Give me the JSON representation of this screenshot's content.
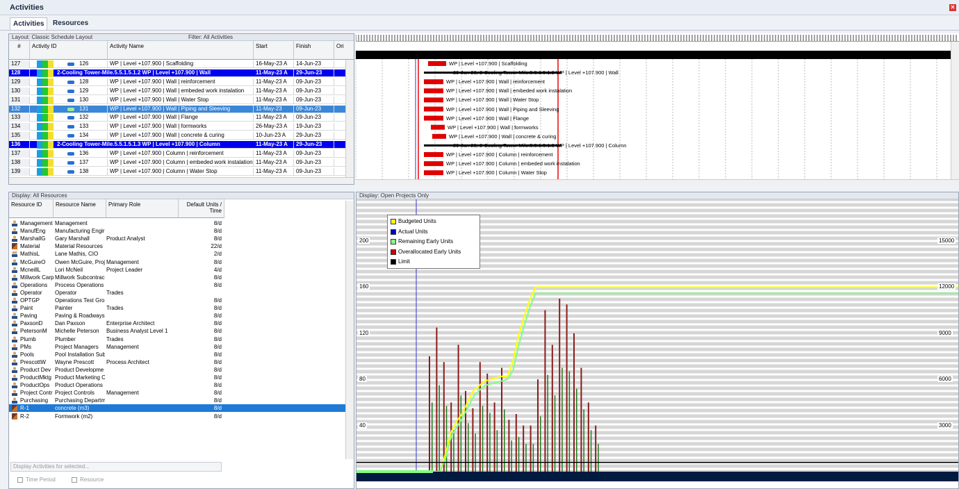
{
  "window": {
    "title": "Activities"
  },
  "tabs": [
    {
      "label": "Activities"
    },
    {
      "label": "Resources"
    }
  ],
  "activity_table": {
    "layout_label": "Layout: Classic Schedule Layout",
    "filter_label": "Filter: All Activities",
    "columns": {
      "num": "#",
      "id": "Activity ID",
      "name": "Activity Name",
      "start": "Start",
      "finish": "Finish",
      "orig": "Ori"
    },
    "rows": [
      {
        "num": "127",
        "id": "126",
        "name": "WP | Level +107.900 | Scaffolding",
        "start": "16-May-23 A",
        "finish": "14-Jun-23"
      },
      {
        "num": "128",
        "id": "2-Cooling Tower-Mile.5.5.1.5.1.2  WP | Level +107.900 | Wall",
        "name": "",
        "start": "11-May-23 A",
        "finish": "29-Jun-23"
      },
      {
        "num": "129",
        "id": "128",
        "name": "WP | Level +107.900 | Wall |  reinforcement",
        "start": "11-May-23 A",
        "finish": "09-Jun-23"
      },
      {
        "num": "130",
        "id": "129",
        "name": "WP | Level +107.900 | Wall | embeded work instalation",
        "start": "11-May-23 A",
        "finish": "09-Jun-23"
      },
      {
        "num": "131",
        "id": "130",
        "name": "WP | Level +107.900 | Wall | Water Stop",
        "start": "11-May-23 A",
        "finish": "09-Jun-23"
      },
      {
        "num": "132",
        "id": "131",
        "name": "WP | Level +107.900 | Wall | Piping and Sleeving",
        "start": "11-May-23",
        "finish": "09-Jun-23"
      },
      {
        "num": "133",
        "id": "132",
        "name": "WP | Level +107.900 | Wall | Flange",
        "start": "11-May-23 A",
        "finish": "09-Jun-23"
      },
      {
        "num": "134",
        "id": "133",
        "name": "WP | Level +107.900 | Wall |  formworks",
        "start": "26-May-23 A",
        "finish": "19-Jun-23"
      },
      {
        "num": "135",
        "id": "134",
        "name": "WP | Level +107.900 | Wall | concrete & curing",
        "start": "10-Jun-23 A",
        "finish": "29-Jun-23"
      },
      {
        "num": "136",
        "id": "2-Cooling Tower-Mile.5.5.1.5.1.3  WP | Level +107.900 | Column",
        "name": "",
        "start": "11-May-23 A",
        "finish": "29-Jun-23"
      },
      {
        "num": "137",
        "id": "136",
        "name": "WP | Level +107.900 | Column |  reinforcement",
        "start": "11-May-23 A",
        "finish": "09-Jun-23"
      },
      {
        "num": "138",
        "id": "137",
        "name": "WP | Level +107.900 | Column | embeded work instalation",
        "start": "11-May-23 A",
        "finish": "09-Jun-23"
      },
      {
        "num": "139",
        "id": "138",
        "name": "WP | Level +107.900 | Column | Water Stop",
        "start": "11-May-23 A",
        "finish": "09-Jun-23"
      }
    ]
  },
  "gantt_labels": [
    "WP | Level +107.900 | Scaffolding",
    "29-Jun-23, 2-Cooling Tower-Mile.5.5.1.5.1.2  WP | Level +107.900 | Wall",
    "WP | Level +107.900 | Wall |  reinforcement",
    "WP | Level +107.900 | Wall | embeded work instalation",
    "WP | Level +107.900 | Wall | Water Stop",
    "WP | Level +107.900 | Wall | Piping and Sleeving",
    "WP | Level +107.900 | Wall | Flange",
    "WP | Level +107.900 | Wall |  formworks",
    "WP | Level +107.900 | Wall | concrete & curing",
    "29-Jun-23, 2-Cooling Tower-Mile.5.5.1.5.1.3  WP | Level +107.900 | Column",
    "WP | Level +107.900 | Column |  reinforcement",
    "WP | Level +107.900 | Column | embeded work instalation",
    "WP | Level +107.900 | Column | Water Stop"
  ],
  "resource_table": {
    "display_label": "Display: All Resources",
    "columns": {
      "id": "Resource ID",
      "name": "Resource Name",
      "role": "Primary Role",
      "units": "Default Units / Time"
    },
    "rows": [
      {
        "icon": "person",
        "id": "Management",
        "name": "Management",
        "role": "",
        "units": "8/d"
      },
      {
        "icon": "person",
        "id": "ManufEng",
        "name": "Manufacturing Engir",
        "role": "",
        "units": "8/d"
      },
      {
        "icon": "person",
        "id": "MarshallG",
        "name": "Gary Marshall",
        "role": "Product Analyst",
        "units": "8/d"
      },
      {
        "icon": "mat",
        "id": "Material",
        "name": "Material Resources",
        "role": "",
        "units": "22/d"
      },
      {
        "icon": "group",
        "id": "MathisL",
        "name": "Lane Mathis, CIO",
        "role": "",
        "units": "2/d"
      },
      {
        "icon": "person",
        "id": "McGuireO",
        "name": "Owen McGuire, Proj",
        "role": "Management",
        "units": "8/d"
      },
      {
        "icon": "person",
        "id": "McneillL",
        "name": "Lori McNeil",
        "role": "Project Leader",
        "units": "4/d"
      },
      {
        "icon": "person",
        "id": "Millwork Carp",
        "name": "Millwork Subcontrac",
        "role": "",
        "units": "8/d"
      },
      {
        "icon": "person",
        "id": "Operations",
        "name": "Process Operations",
        "role": "",
        "units": "8/d"
      },
      {
        "icon": "person",
        "id": "Operator",
        "name": "Operator",
        "role": "Trades",
        "units": ""
      },
      {
        "icon": "person",
        "id": "OPTGP",
        "name": "Operations Test Gro",
        "role": "",
        "units": "8/d"
      },
      {
        "icon": "person",
        "id": "Paint",
        "name": "Painter",
        "role": "Trades",
        "units": "8/d"
      },
      {
        "icon": "person",
        "id": "Paving",
        "name": "Paving & Roadways",
        "role": "",
        "units": "8/d"
      },
      {
        "icon": "person",
        "id": "PaxsonD",
        "name": "Dan Paxson",
        "role": "Enterprise Architect",
        "units": "8/d"
      },
      {
        "icon": "person",
        "id": "PetersonM",
        "name": "Michelle Peterson",
        "role": "Business Analyst Level 1",
        "units": "8/d"
      },
      {
        "icon": "person",
        "id": "Plumb",
        "name": "Plumber",
        "role": "Trades",
        "units": "8/d"
      },
      {
        "icon": "person",
        "id": "PMs",
        "name": "Project Managers",
        "role": "Management",
        "units": "8/d"
      },
      {
        "icon": "person",
        "id": "Pools",
        "name": "Pool Installation Sub",
        "role": "",
        "units": "8/d"
      },
      {
        "icon": "person",
        "id": "PrescottW",
        "name": "Wayne Prescott",
        "role": "Process Architect",
        "units": "8/d"
      },
      {
        "icon": "person",
        "id": "Product Dev",
        "name": "Product Developme",
        "role": "",
        "units": "8/d"
      },
      {
        "icon": "person",
        "id": "ProductMktg",
        "name": "Product Marketing C",
        "role": "",
        "units": "8/d"
      },
      {
        "icon": "person",
        "id": "ProductOps",
        "name": "Product Operations",
        "role": "",
        "units": "8/d"
      },
      {
        "icon": "person",
        "id": "Project Contr",
        "name": "Project Controls",
        "role": "Management",
        "units": "8/d"
      },
      {
        "icon": "person",
        "id": "Purchasing",
        "name": "Purchasing Departm",
        "role": "",
        "units": "8/d"
      },
      {
        "icon": "mat",
        "id": "R-1",
        "name": "concrete (m3)",
        "role": "",
        "units": "8/d"
      },
      {
        "icon": "mat",
        "id": "R-2",
        "name": "Formwork (m2)",
        "role": "",
        "units": "8/d"
      }
    ],
    "display_activities_button": "Display Activities for selected...",
    "time_period_label": "Time Period",
    "resource_label": "Resource"
  },
  "usage_chart": {
    "display_label": "Display: Open Projects Only",
    "legend": [
      {
        "label": "Budgeted Units",
        "color": "#ffff00"
      },
      {
        "label": "Actual Units",
        "color": "#0000cc"
      },
      {
        "label": "Remaining Early Units",
        "color": "#80ff80"
      },
      {
        "label": "Overallocated Early Units",
        "color": "#cc0000"
      },
      {
        "label": "Limit",
        "color": "#000000"
      }
    ]
  },
  "chart_data": {
    "type": "bar",
    "title": "",
    "left_ticks": [
      "200",
      "160",
      "120",
      "80",
      "40"
    ],
    "right_ticks": [
      "15000",
      "12000",
      "9000",
      "6000",
      "3000"
    ],
    "ylim_left": [
      0,
      200
    ],
    "ylim_right": [
      0,
      15000
    ],
    "limit_value": 8,
    "series": [
      {
        "name": "Budgeted Units",
        "type": "line",
        "y": [
          0,
          0,
          0,
          1200,
          2600,
          3300,
          3800,
          4600,
          5300,
          5600,
          5900,
          6000,
          6100,
          6200,
          6200,
          7200,
          8900,
          10100,
          11200,
          12000,
          12000,
          12000,
          12000,
          12000
        ]
      },
      {
        "name": "Remaining Early Units",
        "type": "line",
        "y": [
          0,
          0,
          0,
          900,
          2300,
          2900,
          3500,
          4200,
          4900,
          5300,
          5600,
          5700,
          5800,
          5900,
          6000,
          6600,
          8200,
          9500,
          10700,
          11600,
          11600,
          11600,
          11600,
          11600
        ]
      },
      {
        "name": "Overallocated Early Units",
        "type": "bar",
        "y": [
          100,
          125,
          95,
          60,
          110,
          70,
          55,
          95,
          85,
          60,
          90,
          45,
          50,
          40,
          40,
          80,
          140,
          110,
          150,
          145,
          120,
          90,
          60,
          40
        ]
      }
    ]
  }
}
